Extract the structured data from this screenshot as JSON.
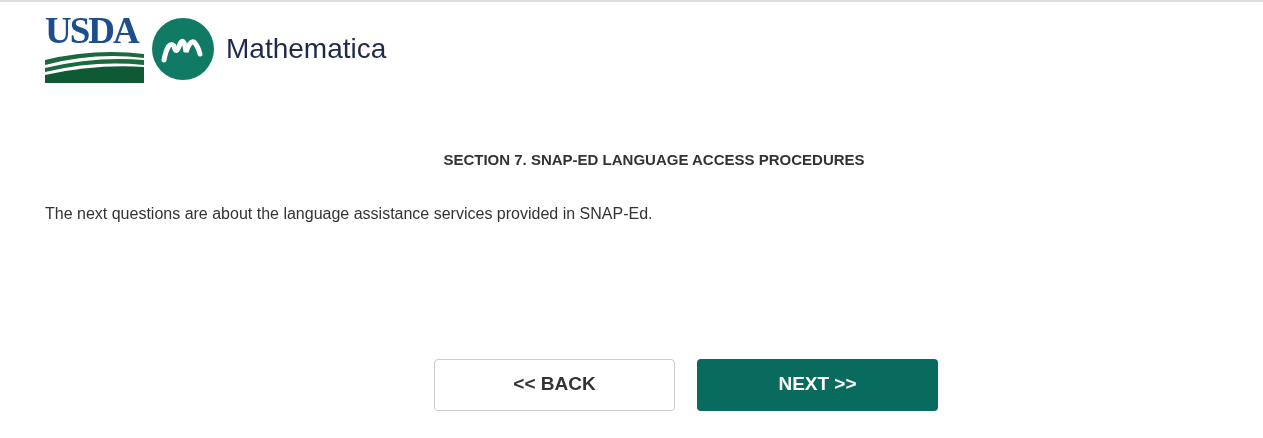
{
  "header": {
    "usda_logo": {
      "text": "USDA"
    },
    "partner_logo": {
      "text": "Mathematica"
    }
  },
  "section_title": "SECTION 7. SNAP-ED LANGUAGE ACCESS PROCEDURES",
  "intro": "The next questions are about the language assistance services provided in SNAP-Ed.",
  "buttons": [
    {
      "label": "<< BACK",
      "kind": "secondary"
    },
    {
      "label": "NEXT >>",
      "kind": "primary"
    }
  ]
}
